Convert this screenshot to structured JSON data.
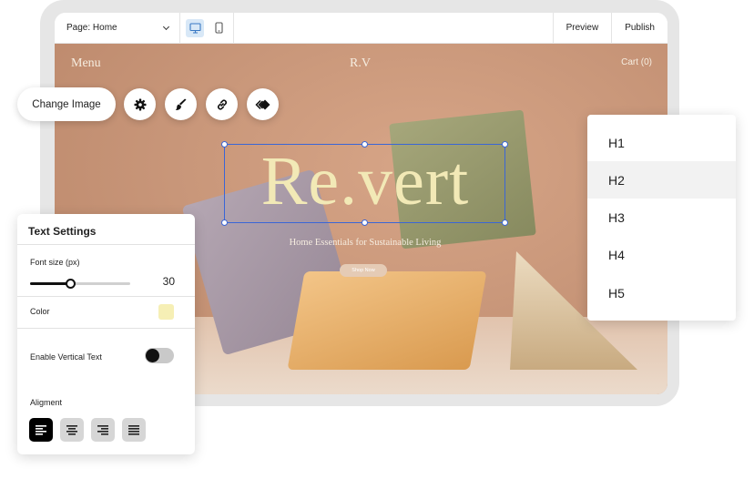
{
  "editor": {
    "page_select": "Page: Home",
    "preview_label": "Preview",
    "publish_label": "Publish",
    "active_view": "desktop"
  },
  "site": {
    "nav_menu": "Menu",
    "brand": "R.V",
    "cart": "Cart (0)",
    "hero_title": "Re.vert",
    "tagline": "Home Essentials for Sustainable Living",
    "shop_button": "Shop Now"
  },
  "image_toolbar": {
    "change_image_label": "Change Image",
    "buttons": [
      "gear-icon",
      "brush-icon",
      "link-icon",
      "animation-icon"
    ]
  },
  "text_settings": {
    "title": "Text Settings",
    "font_size_label": "Font size (px)",
    "font_size_value": "30",
    "font_size_fraction": 0.4,
    "color_label": "Color",
    "color_value": "#f6efb5",
    "vertical_text_label": "Enable Vertical Text",
    "vertical_text_enabled": false,
    "alignment_label": "Aligment",
    "alignment_options": [
      "align-left-icon",
      "align-center-icon",
      "align-right-icon",
      "align-justify-icon"
    ],
    "alignment_selected": "align-left-icon"
  },
  "heading_dropdown": {
    "items": [
      "H1",
      "H2",
      "H3",
      "H4",
      "H5"
    ],
    "selected": "H2"
  },
  "colors": {
    "selection": "#3a66d6",
    "hero_text": "#f2e9b6"
  }
}
